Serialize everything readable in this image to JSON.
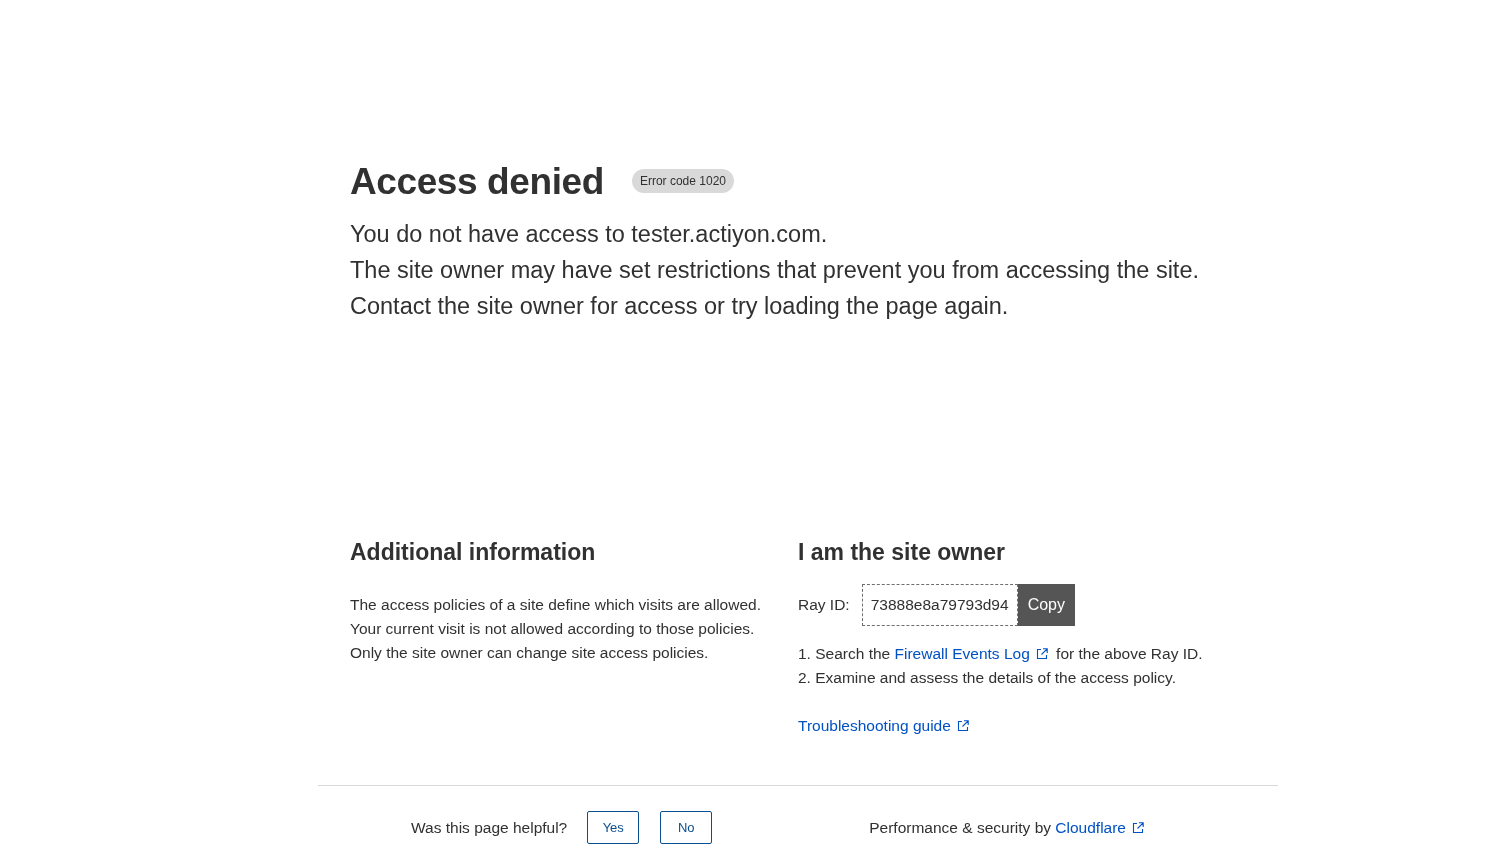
{
  "header": {
    "title": "Access denied",
    "badge": "Error code 1020",
    "message_lines": [
      "You do not have access to tester.actiyon.com.",
      "The site owner may have set restrictions that prevent you from accessing the site.",
      "Contact the site owner for access or try loading the page again."
    ]
  },
  "additional_info": {
    "heading": "Additional information",
    "lines": [
      "The access policies of a site define which visits are allowed.",
      "Your current visit is not allowed according to those policies.",
      "Only the site owner can change site access policies."
    ]
  },
  "site_owner": {
    "heading": "I am the site owner",
    "ray_label": "Ray ID:",
    "ray_id": "73888e8a79793d94",
    "copy_button": "Copy",
    "steps": [
      {
        "number": "1.",
        "text_before": "Search the ",
        "link": "Firewall Events Log",
        "text_after": " for the above Ray ID."
      },
      {
        "number": "2.",
        "text_before": "Examine and assess the details of the access policy."
      }
    ],
    "guide_link": "Troubleshooting guide"
  },
  "footer": {
    "prompt": "Was this page helpful?",
    "feedback_buttons": [
      "Yes",
      "No"
    ],
    "credit_text": "Performance & security by ",
    "credit_link": "Cloudflare"
  }
}
